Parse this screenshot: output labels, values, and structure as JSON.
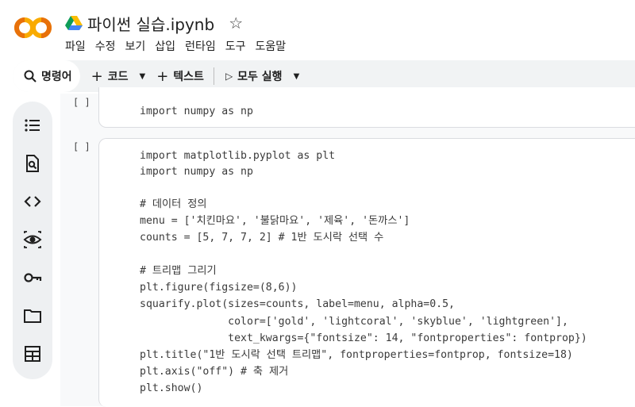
{
  "header": {
    "logo_text": "CO",
    "title": "파이썬 실습.ipynb",
    "star_icon": "star-icon"
  },
  "menu": [
    "파일",
    "수정",
    "보기",
    "삽입",
    "런타임",
    "도구",
    "도움말"
  ],
  "toolbar": {
    "command_label": "명령어",
    "code_label": "코드",
    "text_label": "텍스트",
    "run_all_label": "모두 실행"
  },
  "sidebar": {
    "icons": [
      "toc-icon",
      "find-icon",
      "code-snippets-icon",
      "variables-icon",
      "secrets-key-icon",
      "folder-icon",
      "terminal-table-icon"
    ]
  },
  "cells": {
    "cell1": {
      "bracket": "[ ]",
      "lines": [
        "import numpy as np"
      ]
    },
    "cell2": {
      "bracket": "[ ]",
      "lines": [
        "import matplotlib.pyplot as plt",
        "import numpy as np",
        "",
        "# 데이터 정의",
        "menu = ['치킨마요', '불닭마요', '제육', '돈까스']",
        "counts = [5, 7, 7, 2] # 1반 도시락 선택 수",
        "",
        "# 트리맵 그리기",
        "plt.figure(figsize=(8,6))",
        "squarify.plot(sizes=counts, label=menu, alpha=0.5,",
        "              color=['gold', 'lightcoral', 'skyblue', 'lightgreen'],",
        "              text_kwargs={\"fontsize\": 14, \"fontproperties\": fontprop})",
        "plt.title(\"1반 도시락 선택 트리맵\", fontproperties=fontprop, fontsize=18)",
        "plt.axis(\"off\") # 축 제거",
        "plt.show()"
      ]
    }
  },
  "colors": {
    "logo_orange": "#f9ab00",
    "logo_dark": "#e8710a",
    "toolbar_bg": "#f1f3f4",
    "cell_border": "#dadce0"
  }
}
